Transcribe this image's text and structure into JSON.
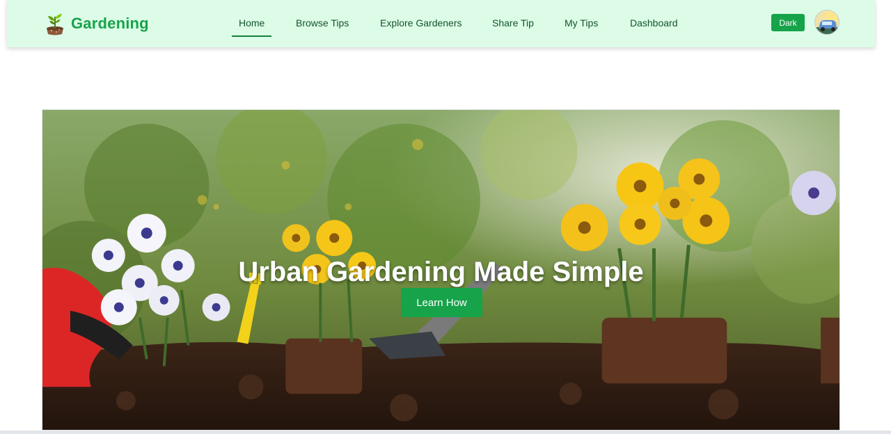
{
  "brand": {
    "name": "Gardening",
    "icon": "sprout-icon"
  },
  "nav": {
    "items": [
      {
        "label": "Home",
        "active": true
      },
      {
        "label": "Browse Tips",
        "active": false
      },
      {
        "label": "Explore Gardeners",
        "active": false
      },
      {
        "label": "Share Tip",
        "active": false
      },
      {
        "label": "My Tips",
        "active": false
      },
      {
        "label": "Dashboard",
        "active": false
      }
    ]
  },
  "theme_toggle": {
    "label": "Dark"
  },
  "user": {
    "avatar_icon": "user-avatar"
  },
  "hero": {
    "title": "Urban Gardening Made Simple",
    "cta_label": "Learn How",
    "image": "garden-flowers-soil-photo"
  },
  "colors": {
    "nav_bg": "#dcfce7",
    "brand": "#16a34a",
    "nav_text": "#14532d",
    "button": "#16a34a"
  }
}
